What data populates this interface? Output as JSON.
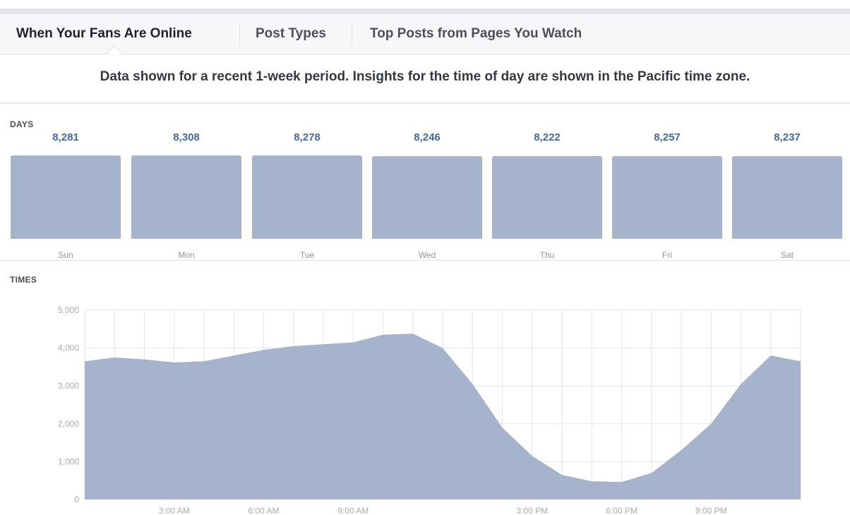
{
  "tabs": [
    {
      "label": "When Your Fans Are Online",
      "active": true
    },
    {
      "label": "Post Types",
      "active": false
    },
    {
      "label": "Top Posts from Pages You Watch",
      "active": false
    }
  ],
  "notice": "Data shown for a recent 1-week period. Insights for the time of day are shown in the Pacific time zone.",
  "sections": {
    "days": "DAYS",
    "times": "TIMES"
  },
  "colors": {
    "bar": "#a5b4cc",
    "area": "#a5b4cc",
    "value_text": "#4267b2",
    "grid": "#e4e6ea"
  },
  "days": [
    {
      "name": "Sun",
      "value": "8,281"
    },
    {
      "name": "Mon",
      "value": "8,308"
    },
    {
      "name": "Tue",
      "value": "8,278"
    },
    {
      "name": "Wed",
      "value": "8,246"
    },
    {
      "name": "Thu",
      "value": "8,222"
    },
    {
      "name": "Fri",
      "value": "8,257"
    },
    {
      "name": "Sat",
      "value": "8,237"
    }
  ],
  "chart_data": [
    {
      "type": "bar",
      "title": "DAYS",
      "categories": [
        "Sun",
        "Mon",
        "Tue",
        "Wed",
        "Thu",
        "Fri",
        "Sat"
      ],
      "values": [
        8281,
        8308,
        8278,
        8246,
        8222,
        8257,
        8237
      ]
    },
    {
      "type": "area",
      "title": "TIMES",
      "x": [
        0,
        1,
        2,
        3,
        4,
        5,
        6,
        7,
        8,
        9,
        10,
        11,
        12,
        13,
        14,
        15,
        16,
        17,
        18,
        19,
        20,
        21,
        22,
        23
      ],
      "values": [
        3650,
        3750,
        3700,
        3620,
        3650,
        3800,
        3950,
        4050,
        4100,
        4150,
        4350,
        4380,
        4000,
        3050,
        1900,
        1150,
        650,
        480,
        460,
        700,
        1300,
        2000,
        3050,
        3800,
        3650
      ],
      "x_tick_positions": [
        3,
        6,
        9,
        15,
        18,
        21
      ],
      "x_tick_labels": [
        "3:00 AM",
        "6:00 AM",
        "9:00 AM",
        "3:00 PM",
        "6:00 PM",
        "9:00 PM"
      ],
      "y_ticks": [
        "0",
        "1,000",
        "2,000",
        "3,000",
        "4,000",
        "5,000"
      ],
      "ylim": [
        0,
        5000
      ],
      "grid": true
    }
  ]
}
